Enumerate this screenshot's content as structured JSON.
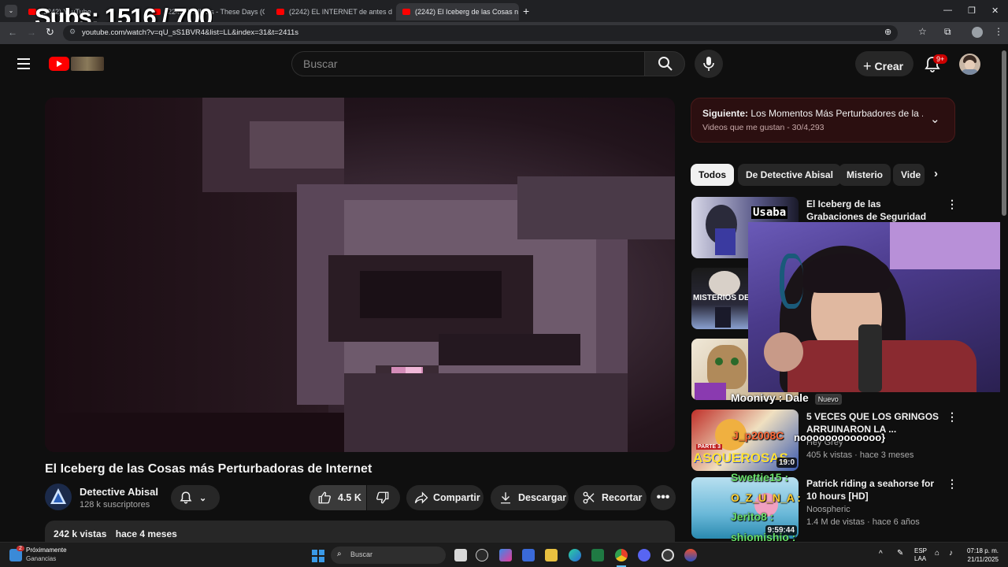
{
  "overlay": {
    "subs_goal": "Subs: 1516 / 700"
  },
  "browser": {
    "tabs": [
      {
        "label": "(2242) YouTube"
      },
      {
        "label": "(2242) Wallows - These Days (O"
      },
      {
        "label": "(2242) EL INTERNET de antes d"
      },
      {
        "label": "(2242) El Iceberg de las Cosas n"
      }
    ],
    "url": "youtube.com/watch?v=qU_sS1BVR4&list=LL&index=31&t=2411s"
  },
  "header": {
    "search_placeholder": "Buscar",
    "create_label": "Crear",
    "notifications_badge": "9+"
  },
  "video": {
    "title": "El Iceberg de las Cosas más Perturbadoras de Internet",
    "channel_name": "Detective Abisal",
    "channel_subs": "128 k suscriptores",
    "likes": "4.5 K",
    "share_label": "Compartir",
    "download_label": "Descargar",
    "clip_label": "Recortar",
    "views": "242 k vistas",
    "age": "hace 4 meses"
  },
  "playlist": {
    "next_prefix": "Siguiente:",
    "next_title": "Los Momentos Más Perturbadores de la ...",
    "subtitle": "Videos que me gustan - 30/4,293"
  },
  "chips": [
    "Todos",
    "De Detective Abisal",
    "Misterio",
    "Vide"
  ],
  "recommendations": [
    {
      "title": "El Iceberg de las Grabaciones de Seguridad más ...",
      "meta": "",
      "thumb_text": "Usaba"
    },
    {
      "title": "",
      "meta": "",
      "thumb_text": "MISTERIOS DE"
    },
    {
      "title": "",
      "meta": "",
      "thumb_text": ""
    },
    {
      "title": "5 VECES QUE LOS GRINGOS ARRUINARON LA ...",
      "channel": "Hey Grey",
      "meta": "405 k vistas · hace 3 meses",
      "thumb_text": "PARTE 3",
      "thumb_text2": "ASQUEROSAS",
      "duration": "19:0"
    },
    {
      "title": "Patrick riding a seahorse for 10 hours [HD]",
      "channel": "Noospheric",
      "meta": "1.4 M de vistas · hace 6 años",
      "duration": "9:59:44"
    }
  ],
  "stream_chat": [
    {
      "text": "Moonivy : Dale",
      "badge": "Nuevo"
    },
    {
      "text": "J_p2008C"
    },
    {
      "text": "nooooooooooooo}"
    },
    {
      "text": "Swettie15 :"
    },
    {
      "text": "O_Z_U_N_A :"
    },
    {
      "text": "Jerito8 :"
    },
    {
      "text": "shiomishio :"
    }
  ],
  "taskbar": {
    "weather_title": "Próximamente",
    "weather_sub": "Ganancias",
    "weather_badge": "2",
    "search_label": "Buscar",
    "lang_line1": "ESP",
    "lang_line2": "LAA",
    "time": "07:18 p. m.",
    "date": "21/11/2025"
  },
  "colors": {
    "youtube_red": "#ff0000",
    "background": "#0f0f0f",
    "chip_active": "#f1f1f1",
    "playlist_bg": "#2b0f10"
  }
}
